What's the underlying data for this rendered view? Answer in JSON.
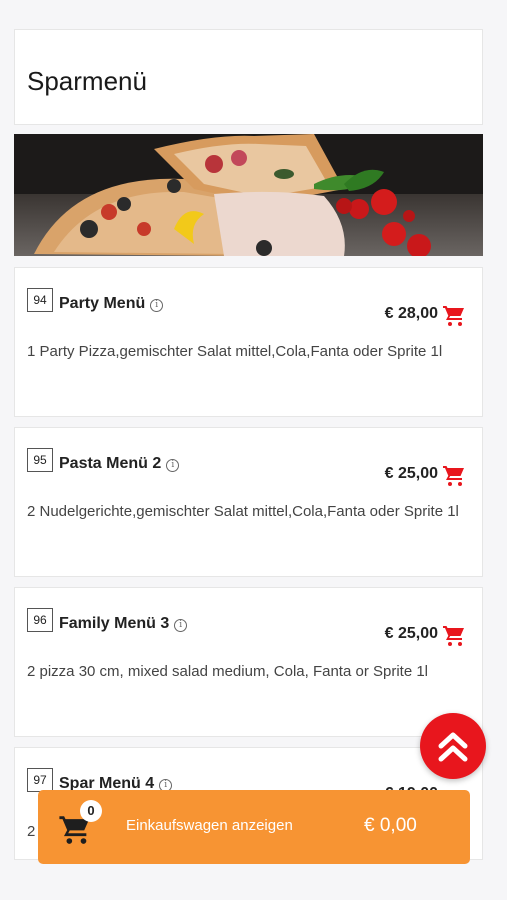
{
  "header": {
    "title": "Sparmenü"
  },
  "items": [
    {
      "number": "94",
      "title": "Party Menü",
      "price": "€ 28,00",
      "description": "1 Party Pizza,gemischter Salat mittel,Cola,Fanta oder Sprite 1l"
    },
    {
      "number": "95",
      "title": "Pasta Menü 2",
      "price": "€ 25,00",
      "description": "2 Nudelgerichte,gemischter Salat mittel,Cola,Fanta oder Sprite 1l"
    },
    {
      "number": "96",
      "title": "Family Menü 3",
      "price": "€ 25,00",
      "description": "2 pizza 30 cm, mixed salad medium, Cola, Fanta or Sprite 1l"
    },
    {
      "number": "97",
      "title": "Spar Menü 4",
      "price": "€ 19,00",
      "description": "2"
    }
  ],
  "cart": {
    "count": "0",
    "label": "Einkaufswagen anzeigen",
    "total": "€ 0,00"
  },
  "icons": {
    "info": "info-icon",
    "cart": "cart-icon",
    "scroll_top": "double-chevron-up-icon"
  },
  "colors": {
    "accent_red": "#e8161d",
    "cart_orange": "#f79433"
  }
}
